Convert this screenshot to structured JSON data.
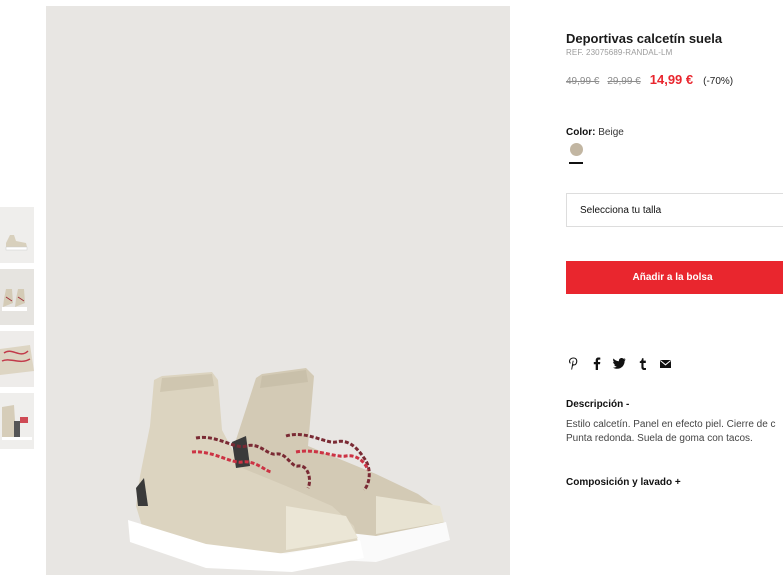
{
  "product": {
    "title": "Deportivas calcetín suela",
    "ref": "REF. 23075689-RANDAL-LM",
    "prices": {
      "original": "49,99 €",
      "previous": "29,99 €",
      "current": "14,99 €",
      "discount": "(-70%)"
    },
    "color": {
      "label": "Color:",
      "value": "Beige",
      "swatch_hex": "#c2b6a2"
    },
    "size_select_label": "Selecciona tu talla",
    "add_button_label": "Añadir a la bolsa",
    "share_icons": [
      "pinterest-icon",
      "facebook-icon",
      "twitter-icon",
      "tumblr-icon",
      "email-icon"
    ],
    "description": {
      "heading": "Descripción  -",
      "lines": [
        "Estilo calcetín. Panel en efecto piel. Cierre de c",
        "Punta redonda. Suela de goma con tacos."
      ]
    },
    "composition_heading": "Composición y lavado  +"
  },
  "accent_color": "#e9262e"
}
